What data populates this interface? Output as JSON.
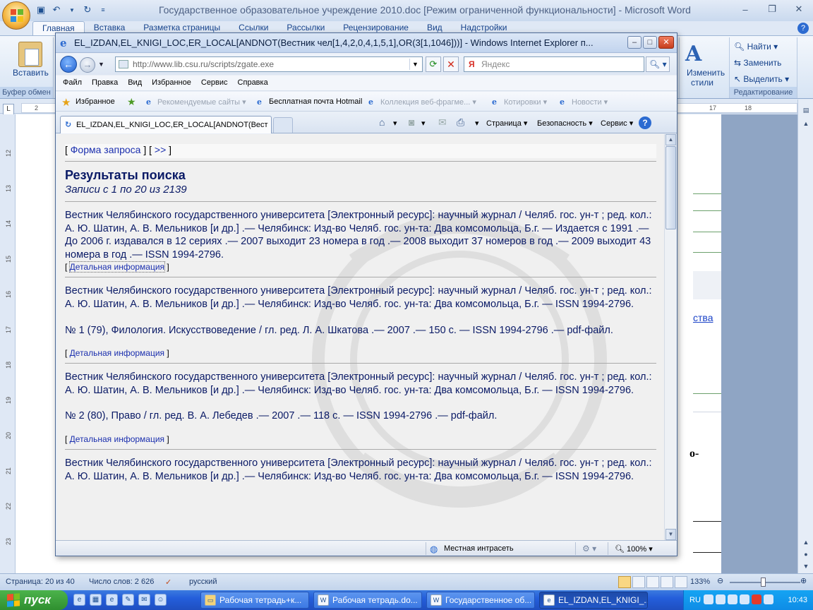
{
  "word": {
    "title": "Государственное образовательное учреждение 2010.doc [Режим ограниченной функциональности] - Microsoft Word",
    "tabs": [
      "Главная",
      "Вставка",
      "Разметка страницы",
      "Ссылки",
      "Рассылки",
      "Рецензирование",
      "Вид",
      "Надстройки"
    ],
    "active_tab": "Главная",
    "ribbon": {
      "paste_label": "Вставить",
      "clipboard_group": "Буфер обмен",
      "change_styles_line1": "Изменить",
      "change_styles_line2": "стили",
      "find_label": "Найти",
      "replace_label": "Заменить",
      "select_label": "Выделить",
      "editing_group": "Редактирование"
    },
    "ruler_box": "L",
    "ruler_top_numbers": [
      "2",
      "17",
      "18"
    ],
    "ruler_left_numbers": [
      "12",
      "13",
      "14",
      "15",
      "16",
      "17",
      "18",
      "19",
      "20",
      "21",
      "22",
      "23"
    ],
    "doc_fragments": {
      "link_tail": "ства",
      "bold_tail": "о-"
    },
    "status": {
      "page": "Страница: 20 из 40",
      "words": "Число слов: 2 626",
      "language": "русский",
      "zoom": "133%"
    }
  },
  "ie": {
    "title": "EL_IZDAN,EL_KNIGI_LOC,ER_LOCAL[ANDNOT(Вестник чел[1,4,2,0,4,1,5,1],OR(3[1,1046]))] - Windows Internet Explorer п...",
    "address": "http://www.lib.csu.ru/scripts/zgate.exe",
    "search_placeholder": "Яндекс",
    "menu": [
      "Файл",
      "Правка",
      "Вид",
      "Избранное",
      "Сервис",
      "Справка"
    ],
    "favorites": {
      "label": "Избранное",
      "items": [
        "Рекомендуемые сайты",
        "Бесплатная почта Hotmail",
        "Коллекция веб-фрагме...",
        "Котировки",
        "Новости"
      ]
    },
    "tab_label": "EL_IZDAN,EL_KNIGI_LOC,ER_LOCAL[ANDNOT(Вестн...",
    "commands": {
      "page": "Страница",
      "security": "Безопасность",
      "tools": "Сервис"
    },
    "status": {
      "zone": "Местная интрасеть",
      "zoom": "100%"
    }
  },
  "page": {
    "nav_open": "[",
    "nav_query_link": "Форма запроса",
    "nav_mid": "] [",
    "nav_next_link": ">>",
    "nav_close": "]",
    "title": "Результаты поиска",
    "subtitle": "Записи с 1 по 20 из 2139",
    "detail_link": "Детальная информация",
    "records": [
      {
        "main": "Вестник Челябинского государственного университета [Электронный ресурс]: научный журнал / Челяб. гос. ун-т ; ред. кол.: А. Ю. Шатин, А. В. Мельников [и др.] .— Челябинск: Изд-во Челяб. гос. ун-та: Два комсомольца, Б.г. — Издается с 1991 .— До 2006 г. издавался в 12 сериях .— 2007 выходит 23 номера в год .— 2008 выходит 37 номеров в год .— 2009 выходит 43 номера в год .— ISSN 1994-2796.",
        "issue": ""
      },
      {
        "main": "Вестник Челябинского государственного университета [Электронный ресурс]: научный журнал / Челяб. гос. ун-т ; ред. кол.: А. Ю. Шатин, А. В. Мельников [и др.] .— Челябинск: Изд-во Челяб. гос. ун-та: Два комсомольца, Б.г. — ISSN 1994-2796.",
        "issue": "№ 1 (79), Филология. Искусствоведение / гл. ред. Л. А. Шкатова .— 2007 .— 150 с. — ISSN 1994-2796 .— pdf-файл."
      },
      {
        "main": "Вестник Челябинского государственного университета [Электронный ресурс]: научный журнал / Челяб. гос. ун-т ; ред. кол.: А. Ю. Шатин, А. В. Мельников [и др.] .— Челябинск: Изд-во Челяб. гос. ун-та: Два комсомольца, Б.г. — ISSN 1994-2796.",
        "issue": "№ 2 (80), Право / гл. ред. В. А. Лебедев .— 2007 .— 118 с. — ISSN 1994-2796 .— pdf-файл."
      },
      {
        "main": "Вестник Челябинского государственного университета [Электронный ресурс]: научный журнал / Челяб. гос. ун-т ; ред. кол.: А. Ю. Шатин, А. В. Мельников [и др.] .— Челябинск: Изд-во Челяб. гос. ун-та: Два комсомольца, Б.г. — ISSN 1994-2796.",
        "issue": ""
      }
    ]
  },
  "taskbar": {
    "start": "пуск",
    "buttons": [
      "Рабочая тетрадь+к...",
      "Рабочая тетрадь.do...",
      "Государственное об...",
      "EL_IZDAN,EL_KNIGI_..."
    ],
    "active_index": 3,
    "lang": "RU",
    "clock": "10:43"
  },
  "colors": {
    "link": "#1b2fae",
    "record_text": "#0a1a66",
    "taskbar": "#245edb",
    "start": "#2f8f2f"
  }
}
